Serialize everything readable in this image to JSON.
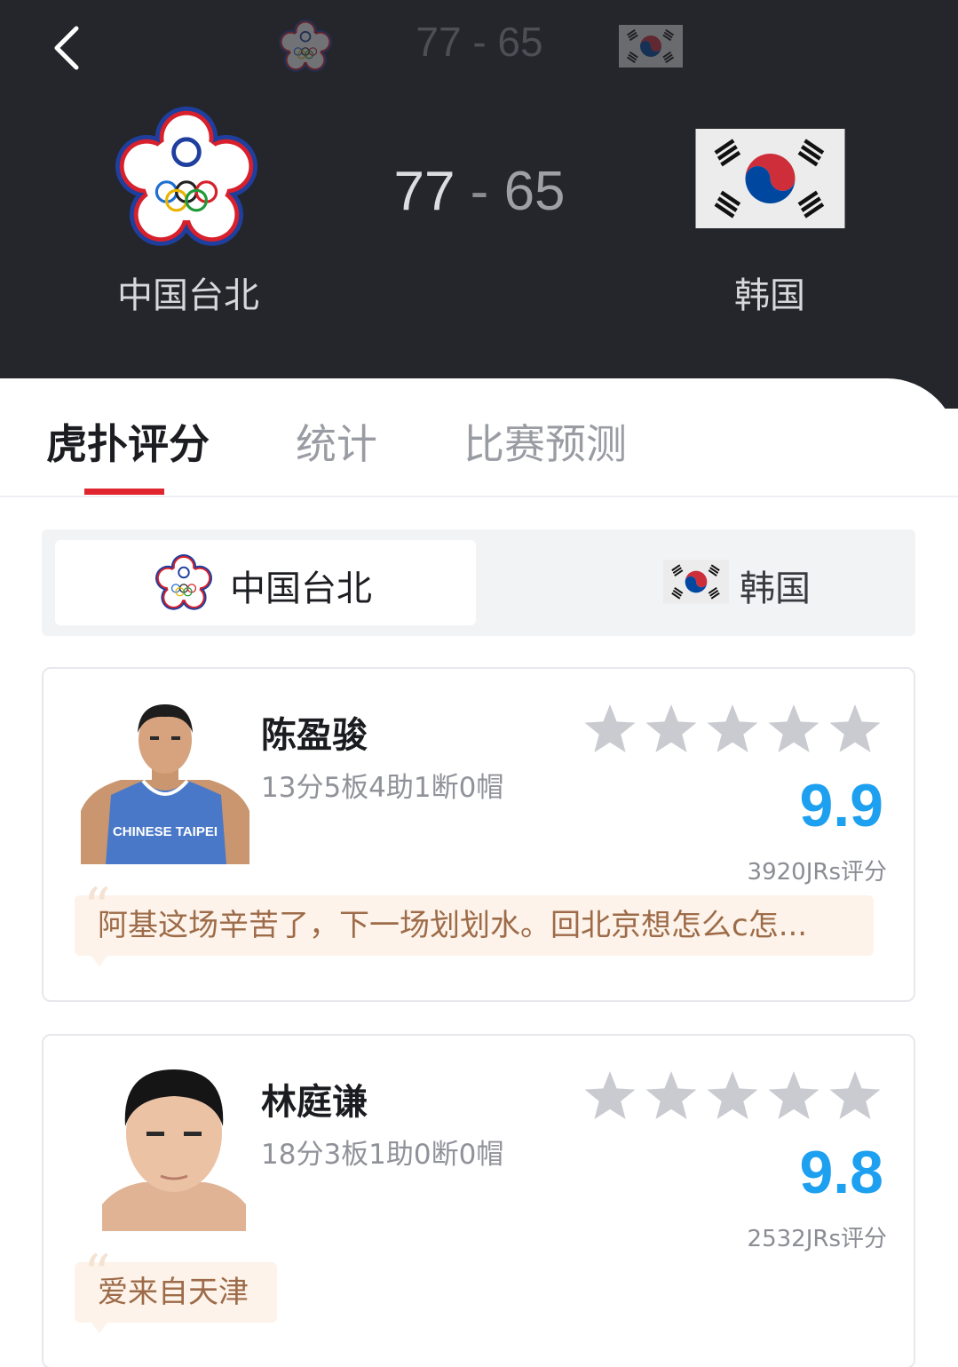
{
  "header": {
    "mini_score": "77 - 65",
    "home_score": "77",
    "score_separator": "-",
    "away_score": "65",
    "home_team": "中国台北",
    "away_team": "韩国"
  },
  "tabs": [
    {
      "label": "虎扑评分",
      "active": true
    },
    {
      "label": "统计",
      "active": false
    },
    {
      "label": "比赛预测",
      "active": false
    }
  ],
  "team_switch": {
    "home_label": "中国台北",
    "away_label": "韩国",
    "selected": "home"
  },
  "players": [
    {
      "name": "陈盈骏",
      "stats": "13分5板4助1断0帽",
      "rating": "9.9",
      "votes": "3920JRs评分",
      "comment": "阿基这场辛苦了，下一场划划水。回北京想怎么c怎...",
      "jersey_text": "CHINESE TAIPEI"
    },
    {
      "name": "林庭谦",
      "stats": "18分3板1助0断0帽",
      "rating": "9.8",
      "votes": "2532JRs评分",
      "comment": "爱来自天津"
    }
  ],
  "colors": {
    "header_bg": "#25262b",
    "tab_indicator": "#e0252f",
    "rating_blue": "#1ea0f0",
    "comment_bg": "#fdf3ea",
    "comment_text": "#9d6b48",
    "star_gray": "#c9cbd0"
  },
  "icons": [
    "back-chevron-icon",
    "chinese-taipei-emblem-icon",
    "korea-flag-icon",
    "star-icon",
    "quote-icon"
  ]
}
